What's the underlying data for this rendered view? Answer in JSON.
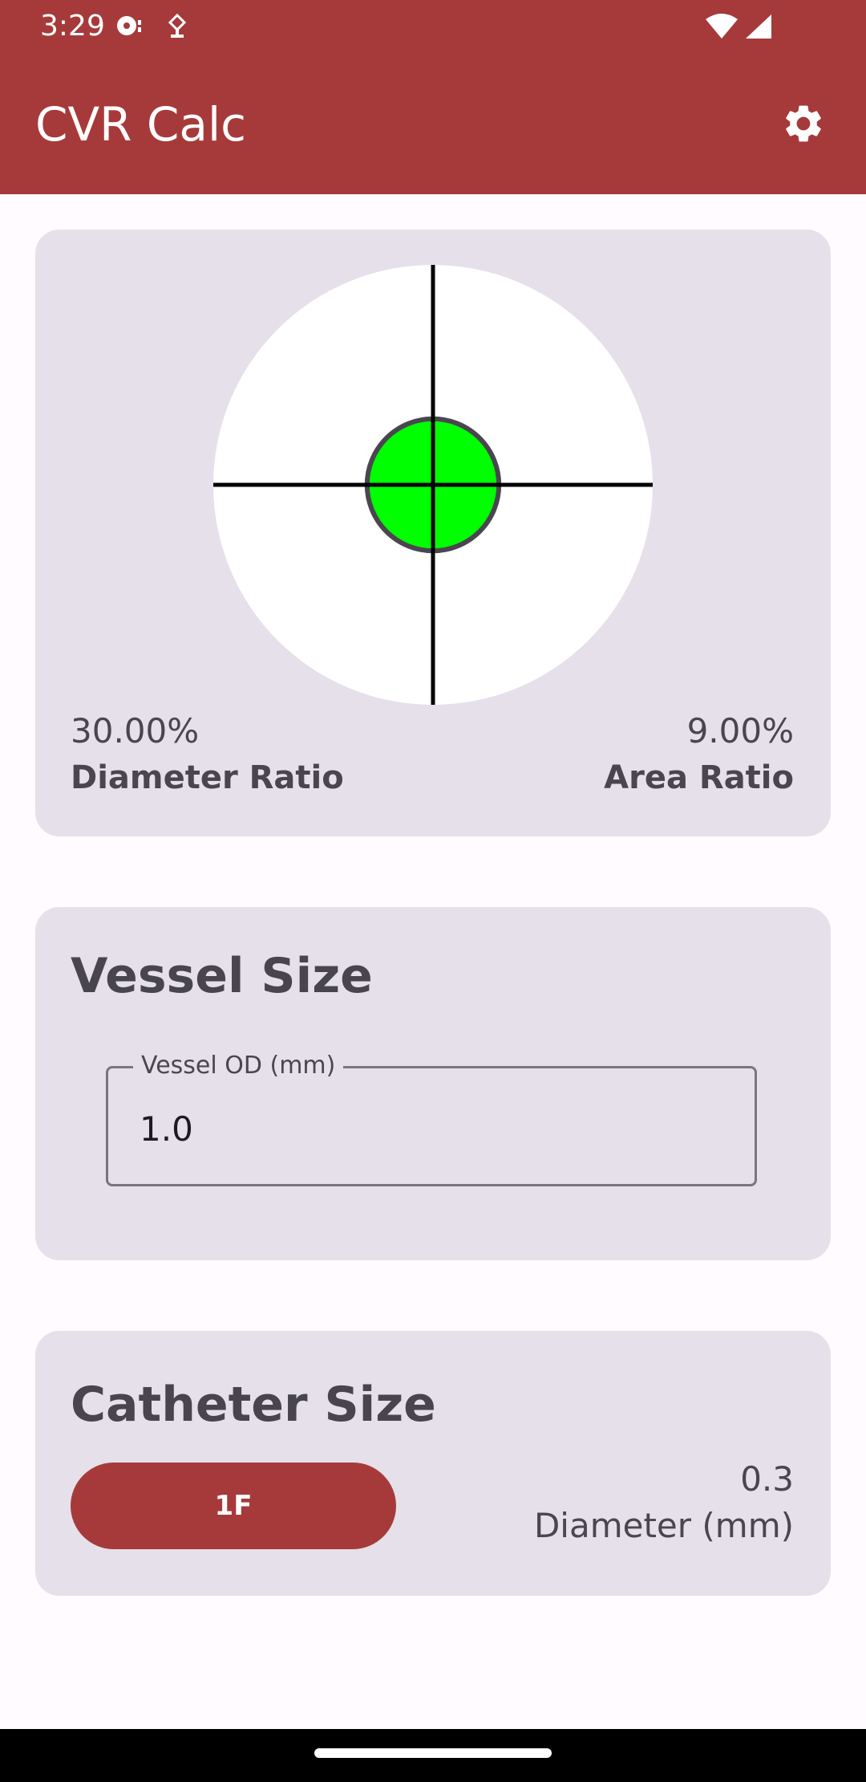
{
  "status_bar": {
    "time": "3:29"
  },
  "app_bar": {
    "title": "CVR Calc",
    "settings_icon": "gear-icon",
    "background_color": "#A63A3A"
  },
  "visual": {
    "diameter_ratio_value": "30.00%",
    "diameter_ratio_label": "Diameter Ratio",
    "area_ratio_value": "9.00%",
    "area_ratio_label": "Area Ratio",
    "catheter_fill_color": "#00FF00",
    "diameter_ratio_fraction": 0.3
  },
  "vessel": {
    "title": "Vessel Size",
    "field_label": "Vessel OD (mm)",
    "field_value": "1.0"
  },
  "catheter": {
    "title": "Catheter Size",
    "button_label": "1F",
    "diameter_value": "0.3",
    "diameter_label": "Diameter (mm)"
  }
}
